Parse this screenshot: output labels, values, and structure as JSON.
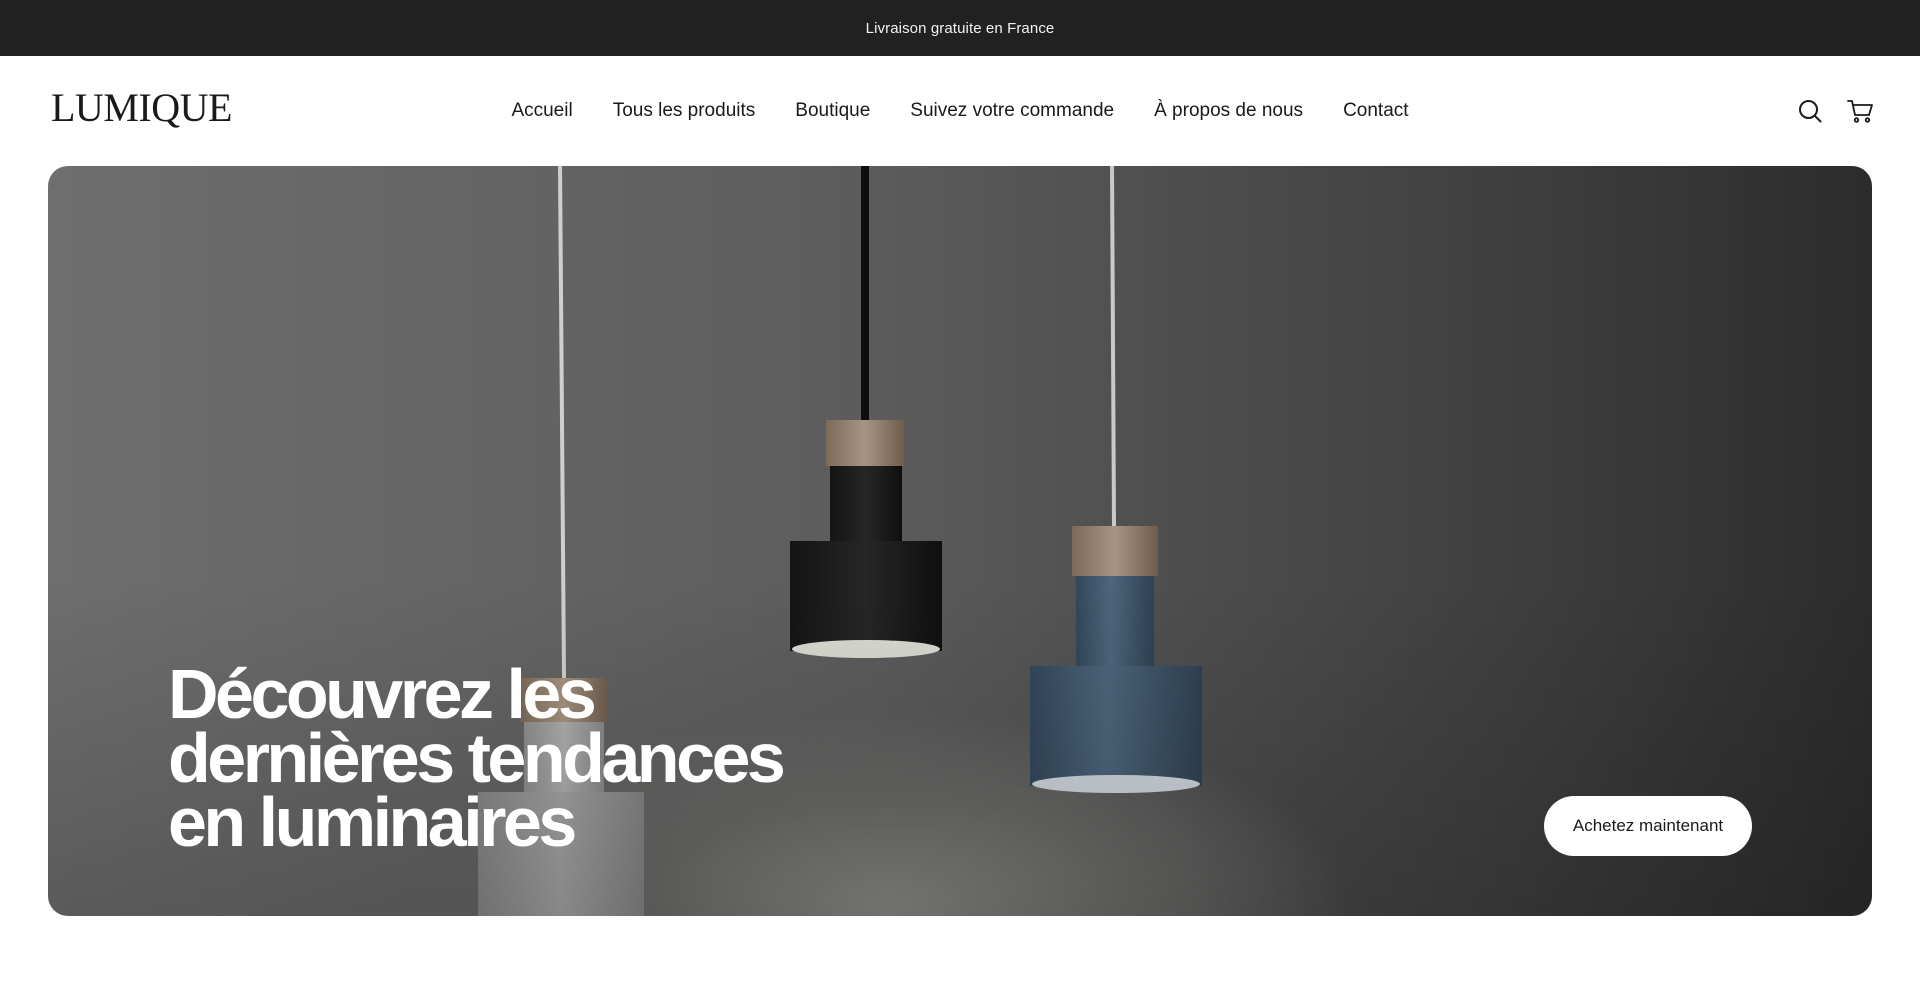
{
  "announcement": {
    "text": "Livraison gratuite en France"
  },
  "header": {
    "logo": "LUMIQUE",
    "nav": [
      {
        "label": "Accueil"
      },
      {
        "label": "Tous les produits"
      },
      {
        "label": "Boutique"
      },
      {
        "label": "Suivez votre commande"
      },
      {
        "label": "À propos de nous"
      },
      {
        "label": "Contact"
      }
    ],
    "icons": {
      "search": "search-icon",
      "cart": "cart-icon"
    }
  },
  "hero": {
    "title_lines": [
      "Découvrez les",
      "dernières tendances",
      "en luminaires"
    ],
    "cta_label": "Achetez maintenant"
  },
  "colors": {
    "announcement_bg": "#212121",
    "page_bg": "#ffffff",
    "hero_text": "#ffffff",
    "cta_bg": "#ffffff"
  }
}
